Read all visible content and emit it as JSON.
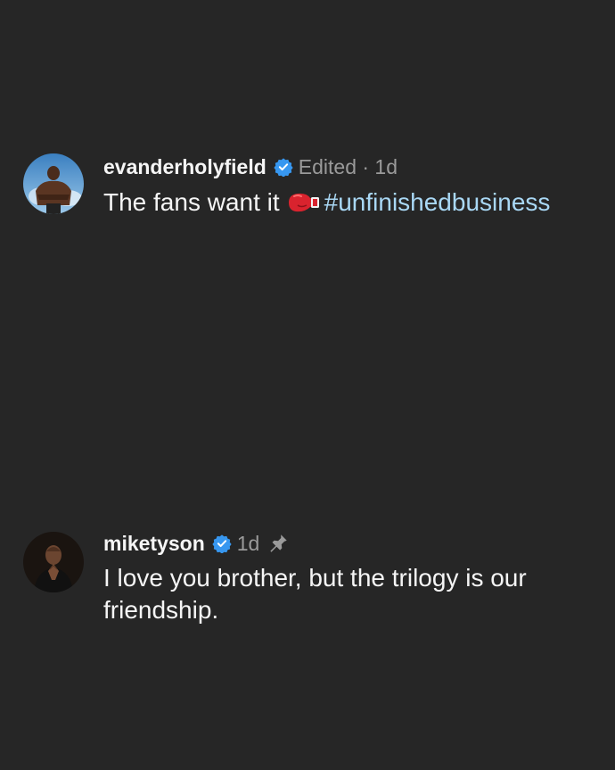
{
  "comments": [
    {
      "username": "evanderholyfield",
      "meta": "Edited · 1d",
      "text": "The fans want it",
      "emoji": "boxing-glove-icon",
      "hashtag": "#unfinishedbusiness",
      "verified": true
    },
    {
      "username": "miketyson",
      "meta": "1d",
      "text": "I love you brother, but the trilogy is our friendship.",
      "verified": true,
      "pinned": true
    }
  ],
  "colors": {
    "background": "#262626",
    "text": "#f5f5f5",
    "meta": "#9a9a9a",
    "hashtag": "#a9d8f5",
    "verified": "#3797f0"
  }
}
